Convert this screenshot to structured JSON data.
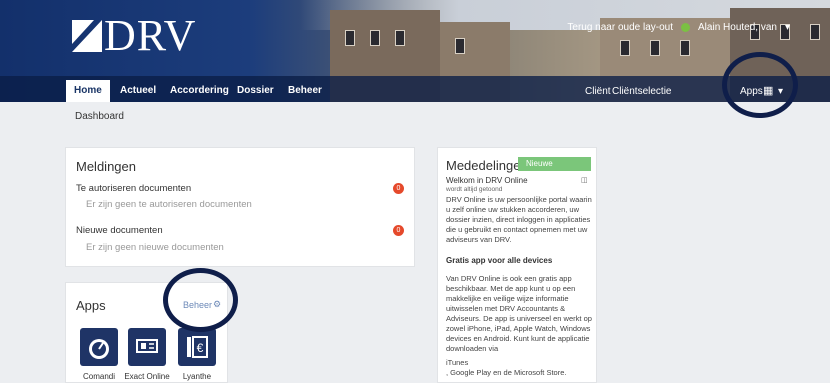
{
  "header": {
    "logo_text": "DRV",
    "back_link": "Terug naar oude lay-out",
    "user": "Alain Houted, van",
    "client_label": "Cliënt",
    "client_select": "Cliëntselectie",
    "apps_label": "Apps"
  },
  "nav": {
    "tabs": [
      {
        "label": "Home",
        "active": true
      },
      {
        "label": "Actueel"
      },
      {
        "label": "Accordering"
      },
      {
        "label": "Dossier"
      },
      {
        "label": "Beheer"
      }
    ]
  },
  "page": {
    "subtitle": "Dashboard"
  },
  "meldingen": {
    "title": "Meldingen",
    "rows": [
      {
        "title": "Te autoriseren documenten",
        "empty": "Er zijn geen te autoriseren documenten",
        "count": "0"
      },
      {
        "title": "Nieuwe documenten",
        "empty": "Er zijn geen nieuwe documenten",
        "count": "0"
      }
    ]
  },
  "mededelingen": {
    "title": "Mededelingen",
    "badge": "Nieuwe",
    "item_title": "Welkom in DRV Online",
    "item_sub": "wordt altijd getoond",
    "item_body": "DRV Online is uw persoonlijke portal waarin u zelf online uw stukken accorderen, uw dossier inzien, direct inloggen in applicaties die u gebruikt en contact opnemen met uw adviseurs van DRV.",
    "section_title": "Gratis app voor alle devices",
    "section_body": "Van DRV Online is ook een gratis app beschikbaar. Met de app kunt u op een makkelijke en veilige wijze informatie uitwisselen met DRV Accountants & Adviseurs. De app is universeel en werkt op zowel iPhone, iPad, Apple Watch, Windows devices en Android. Kunt kunt de applicatie downloaden via",
    "line1": "iTunes",
    "line2": ", Google Play en de Microsoft Store."
  },
  "apps": {
    "title": "Apps",
    "beheer_label": "Beheer",
    "items": [
      {
        "label": "Comandi",
        "icon": "dashboard-icon"
      },
      {
        "label": "Exact Online",
        "icon": "exact-icon"
      },
      {
        "label": "Lyanthe",
        "icon": "euro-icon"
      }
    ]
  },
  "colors": {
    "brand": "#1f3466",
    "badge": "#7bc67a",
    "alert": "#e5492b"
  }
}
